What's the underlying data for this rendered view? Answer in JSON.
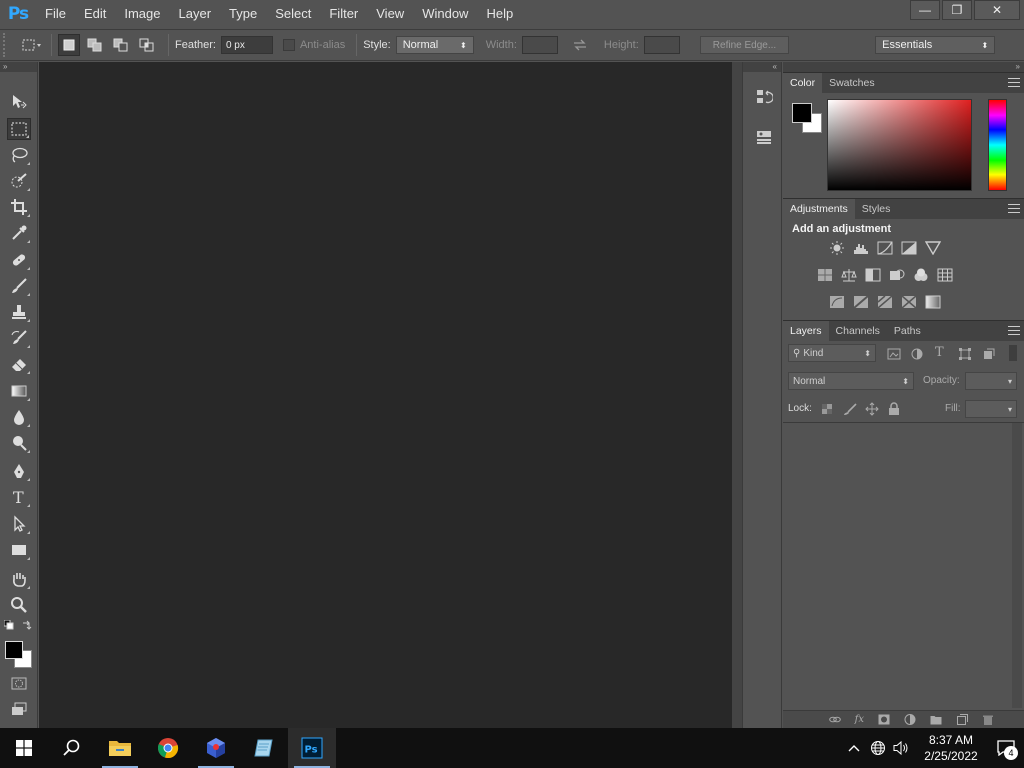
{
  "app": {
    "logo": "Ps",
    "menu": [
      "File",
      "Edit",
      "Image",
      "Layer",
      "Type",
      "Select",
      "Filter",
      "View",
      "Window",
      "Help"
    ],
    "window_controls": {
      "minimize": "—",
      "restore": "❐",
      "close": "✕"
    }
  },
  "options_bar": {
    "feather_label": "Feather:",
    "feather_value": "0 px",
    "antialias_label": "Anti-alias",
    "style_label": "Style:",
    "style_value": "Normal",
    "width_label": "Width:",
    "height_label": "Height:",
    "refine_edge_label": "Refine Edge...",
    "workspace_value": "Essentials"
  },
  "tools_panel": {
    "collapse_glyph": "»",
    "tools": [
      "move",
      "rectangular-marquee",
      "lasso",
      "quick-selection",
      "crop",
      "eyedropper",
      "spot-healing",
      "brush",
      "clone-stamp",
      "history-brush",
      "eraser",
      "gradient",
      "blur",
      "dodge",
      "pen",
      "type",
      "path-selection",
      "rectangle",
      "hand",
      "zoom"
    ],
    "active_tool": "rectangular-marquee",
    "foreground_color": "#000000",
    "background_color": "#ffffff"
  },
  "dock": {
    "collapse_glyph": "«"
  },
  "panels": {
    "collapse_glyph": "»",
    "color": {
      "tabs": [
        "Color",
        "Swatches"
      ],
      "active_tab": "Color",
      "foreground_color": "#000000",
      "background_color": "#ffffff"
    },
    "adjustments": {
      "tabs": [
        "Adjustments",
        "Styles"
      ],
      "active_tab": "Adjustments",
      "heading": "Add an adjustment"
    },
    "layers": {
      "tabs": [
        "Layers",
        "Channels",
        "Paths"
      ],
      "active_tab": "Layers",
      "filter_kind": "Kind",
      "blend_mode": "Normal",
      "opacity_label": "Opacity:",
      "lock_label": "Lock:",
      "fill_label": "Fill:"
    }
  },
  "taskbar": {
    "apps": [
      "start",
      "search",
      "file-explorer",
      "chrome",
      "3d-app",
      "notepad",
      "photoshop"
    ],
    "active_app": "photoshop",
    "time": "8:37 AM",
    "date": "2/25/2022",
    "notification_count": "4"
  }
}
